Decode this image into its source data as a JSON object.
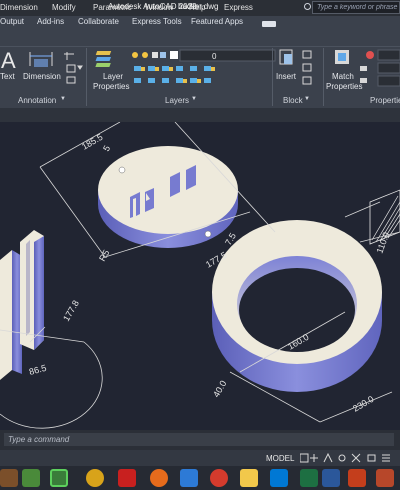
{
  "window": {
    "title": "Autodesk AutoCAD 2022",
    "file": "backer.dwg",
    "search_placeholder": "Type a keyword or phrase"
  },
  "menu": [
    "Dimension",
    "Modify",
    "Parametric",
    "Window",
    "Help",
    "Express"
  ],
  "tabs": [
    "Output",
    "Add-ins",
    "Collaborate",
    "Express Tools",
    "Featured Apps"
  ],
  "ribbon": {
    "text_label": "Text",
    "dimension_label": "Dimension",
    "layer_properties_label": [
      "Layer",
      "Properties"
    ],
    "layer_value": "0",
    "insert_label": "Insert",
    "match_properties_label": [
      "Match",
      "Properties"
    ],
    "panels": [
      "Annotation",
      "Layers",
      "Block",
      "Properties"
    ]
  },
  "drawing": {
    "dims": [
      "185.5",
      "177.5",
      "177.8",
      "86.5",
      "160.0",
      "230.0",
      "110.0",
      "7.5",
      "5",
      "R5",
      "40.0"
    ]
  },
  "command": {
    "placeholder": "Type a command"
  },
  "status": {
    "model": "MODEL"
  },
  "colors": {
    "accent": "#6f73c9",
    "canvas": "#212532",
    "ribbon": "#3b414c",
    "part_face": "#eeeadc"
  }
}
